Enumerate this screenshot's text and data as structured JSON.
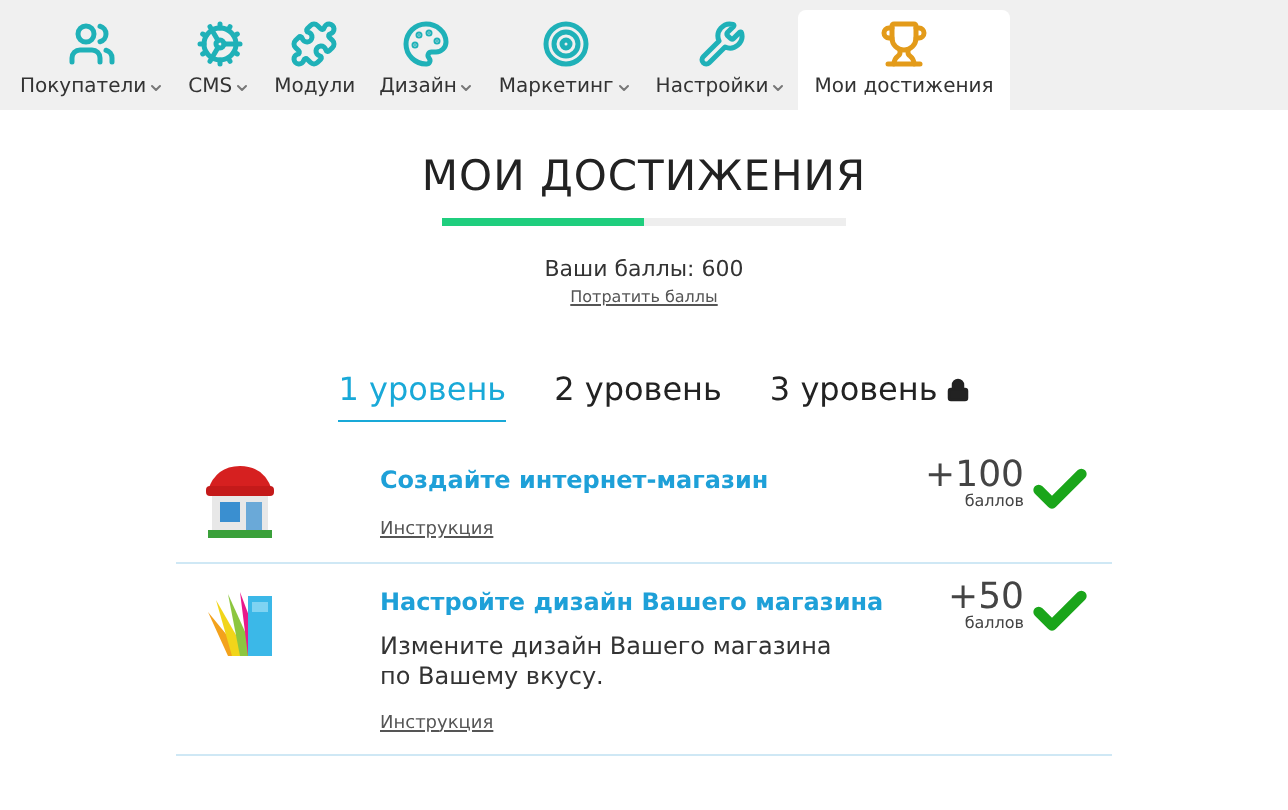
{
  "nav": [
    {
      "label": "Покупатели",
      "dropdown": true,
      "selected": false
    },
    {
      "label": "CMS",
      "dropdown": true,
      "selected": false
    },
    {
      "label": "Модули",
      "dropdown": false,
      "selected": false
    },
    {
      "label": "Дизайн",
      "dropdown": true,
      "selected": false
    },
    {
      "label": "Маркетинг",
      "dropdown": true,
      "selected": false
    },
    {
      "label": "Настройки",
      "dropdown": true,
      "selected": false
    },
    {
      "label": "Мои достижения",
      "dropdown": false,
      "selected": true
    }
  ],
  "heading": "МОИ ДОСТИЖЕНИЯ",
  "progress": {
    "level": 0.5
  },
  "points": "Ваши баллы: 600",
  "spend_link": "Потратить баллы",
  "levels": [
    {
      "label": "1 уровень",
      "selected": true,
      "locked": false
    },
    {
      "label": "2 уровень",
      "selected": false,
      "locked": false
    },
    {
      "label": "3 уровень",
      "selected": false,
      "locked": true
    }
  ],
  "tasks": [
    {
      "kind": "shop",
      "title": "Создайте интернет-магазин",
      "link": "Инструкция",
      "points": "+100",
      "unit": "баллов",
      "done": true
    },
    {
      "kind": "swatches",
      "title": "Настройте дизайн Вашего магазина",
      "description": "Измените дизайн Вашего магазина по Вашему вкусу.",
      "link": "Инструкция",
      "points": "+50",
      "unit": "баллов",
      "done": true
    }
  ]
}
